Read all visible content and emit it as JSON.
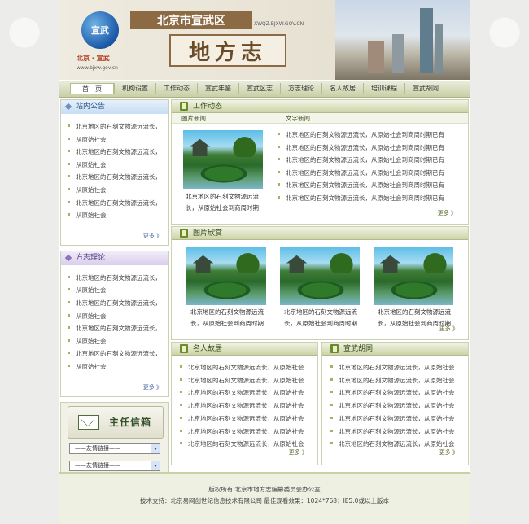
{
  "header": {
    "site_title": "北京市宣武区",
    "site_url": "XWQZ.BJXW.GOV.CN",
    "main_title": "地方志",
    "logo_text": "宣武",
    "logo_sub": "北京 · 宣武",
    "logo_url": "www.bjxw.gov.cn"
  },
  "nav": {
    "items": [
      "首　页",
      "机构设置",
      "工作动态",
      "宣武年鉴",
      "宣武区志",
      "方志理论",
      "名人故居",
      "培训课程",
      "宣武胡同"
    ]
  },
  "sidebar": {
    "notice": {
      "title": "站内公告",
      "items": [
        "北京地区的石刻文物源远流长，",
        "从原始社会",
        "北京地区的石刻文物源远流长，",
        "从原始社会",
        "北京地区的石刻文物源远流长，",
        "从原始社会",
        "北京地区的石刻文物源远流长，",
        "从原始社会"
      ],
      "more": "更多 》"
    },
    "theory": {
      "title": "方志理论",
      "items": [
        "北京地区的石刻文物源远流长，",
        "从原始社会",
        "北京地区的石刻文物源远流长，",
        "从原始社会",
        "北京地区的石刻文物源远流长，",
        "从原始社会",
        "北京地区的石刻文物源远流长，",
        "从原始社会"
      ],
      "more": "更多 》"
    },
    "mailbox": {
      "label": "主任信箱",
      "select1": "——友情链接——",
      "select2": "——友情链接——"
    }
  },
  "work_news": {
    "title": "工作动态",
    "photo_label": "图片新闻",
    "text_label": "文字新闻",
    "photo_caption_1": "北京地区的石刻文物源远流",
    "photo_caption_2": "长，从原始社会到商周时期",
    "items": [
      "北京地区的石刻文物源远流长，从原始社会到商周时期已有",
      "北京地区的石刻文物源远流长，从原始社会到商周时期已有",
      "北京地区的石刻文物源远流长，从原始社会到商周时期已有",
      "北京地区的石刻文物源远流长，从原始社会到商周时期已有",
      "北京地区的石刻文物源远流长，从原始社会到商周时期已有",
      "北京地区的石刻文物源远流长，从原始社会到商周时期已有"
    ],
    "more": "更多 》"
  },
  "gallery": {
    "title": "图片欣赏",
    "items": [
      {
        "caption_1": "北京地区的石刻文物源远流",
        "caption_2": "长，从原始社会到商周时期"
      },
      {
        "caption_1": "北京地区的石刻文物源远流",
        "caption_2": "长，从原始社会到商周时期"
      },
      {
        "caption_1": "北京地区的石刻文物源远流",
        "caption_2": "长，从原始社会到商周时期"
      }
    ],
    "more": "更多 》"
  },
  "residences": {
    "title": "名人故居",
    "items": [
      "北京地区的石刻文物源远流长，从原始社会",
      "北京地区的石刻文物源远流长，从原始社会",
      "北京地区的石刻文物源远流长，从原始社会",
      "北京地区的石刻文物源远流长，从原始社会",
      "北京地区的石刻文物源远流长，从原始社会",
      "北京地区的石刻文物源远流长，从原始社会",
      "北京地区的石刻文物源远流长，从原始社会"
    ],
    "more": "更多 》"
  },
  "hutong": {
    "title": "宣武胡同",
    "items": [
      "北京地区的石刻文物源远流长，从原始社会",
      "北京地区的石刻文物源远流长，从原始社会",
      "北京地区的石刻文物源远流长，从原始社会",
      "北京地区的石刻文物源远流长，从原始社会",
      "北京地区的石刻文物源远流长，从原始社会",
      "北京地区的石刻文物源远流长，从原始社会",
      "北京地区的石刻文物源远流长，从原始社会"
    ],
    "more": "更多 》"
  },
  "footer": {
    "line1": "版权所有  北京市地方志编纂委员会办公室",
    "line2": "技术支持：北京易网创世纪信息技术有限公司  最佳观看效果：1024*768；IE5.0或以上版本"
  }
}
